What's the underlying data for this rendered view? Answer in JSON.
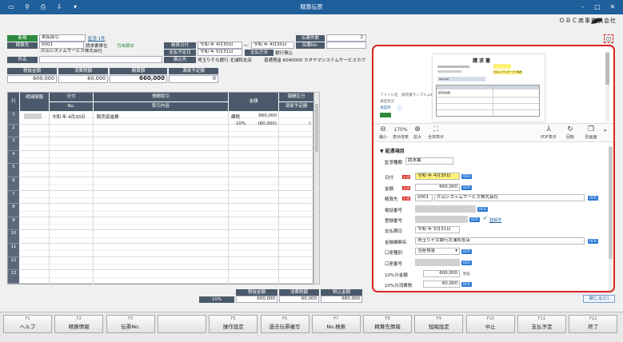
{
  "window": {
    "title": "精算伝票",
    "company": "ＯＢＣ商事株式会社"
  },
  "header": {
    "new_label": "新規",
    "doc_type": "未払取引",
    "voucher_link": "証憑 1件",
    "settlement_date_label": "精算日付",
    "era": "令和",
    "year_unit": "年",
    "settle_from": "4月30日",
    "tilde": "～",
    "settle_to": "4月30日",
    "doc_count_label": "伝票件数",
    "doc_count": "2",
    "payee_label": "精算先",
    "payee_code": "0001",
    "request_unit": "請求書単位",
    "month_end": "月末締め",
    "payment_date_label": "支払予定日",
    "payment_date": "5月31日",
    "payment_method_label": "支払方法",
    "payment_method": "銀行振込",
    "doc_no_label": "伝票No.",
    "payee_name": "片山システムサービス株式会社",
    "subject_label": "件名",
    "transfer_label": "振込先",
    "bank": "埼玉りそな銀行 北浦和支店",
    "account": "普通預金 6040000 カタヤマシステムサービスカブシ"
  },
  "amounts": {
    "tax_excl_label": "税抜金額",
    "tax_label": "消費税額",
    "settle_label": "精算額",
    "adjust_label": "源泉予定額",
    "tax_excl": "600,000",
    "tax": "60,000",
    "settle": "660,000",
    "adjust": "0"
  },
  "grid": {
    "col_row": "行",
    "col_detail": "明細情報",
    "col_date": "日付",
    "col_no": "No.",
    "col_deal": "債務取引",
    "col_content": "取引内容",
    "col_amount": "金額",
    "col_cls": "報酬区分",
    "col_wh": "源泉予定額",
    "row1": {
      "era": "令和",
      "year_unit": "年",
      "date": "4月30日",
      "content": "販売促進費",
      "tax_type": "課税",
      "amount": "660,000",
      "rate": "10%",
      "tax": "(60,000)",
      "withholding": "0"
    },
    "row_numbers": [
      "1",
      "2",
      "3",
      "4",
      "5",
      "6",
      "7",
      "8",
      "9",
      "10",
      "11",
      "12",
      "13"
    ]
  },
  "totals": {
    "tax_excl_label": "税抜金額",
    "tax_label": "消費税額",
    "incl_label": "税込金額",
    "rate": "10%",
    "tax_excl": "600,000",
    "tax": "60,000",
    "incl": "660,000"
  },
  "preview": {
    "zoom": "170%",
    "shrink": "縮小",
    "fit": "表示倍率",
    "enlarge": "拡大",
    "full": "全体表示",
    "pdf": "PDF表示",
    "rotate": "回転",
    "close_view": "別画面",
    "file_name_label": "ファイル名",
    "file_name": "請求書サンプル.pdf",
    "edit_label": "承認状況",
    "status": "承認済",
    "doc_heading": "請求書",
    "doc_company": "片山システムサービス株式会社",
    "doc_item": "販売促進費",
    "doc_total": "660,000"
  },
  "form": {
    "section": "証憑項目",
    "voucher_type_label": "証憑種類",
    "voucher_type": "請求書",
    "date_label": "日付",
    "date_era": "令和",
    "date_year_unit": "年",
    "date_value": "4月30日",
    "amount_label": "金額",
    "amount": "660,000",
    "payee_label": "精算先",
    "payee_code": "0001",
    "payee_name": "片山システムサービス株式会社",
    "phone_label": "電話番号",
    "reg_label": "登録番号",
    "registered": "登録済",
    "due_label": "支払期日",
    "due_era": "令和",
    "due_year_unit": "年",
    "due_date": "5月31日",
    "bank_label": "金融機関名",
    "bank_name": "埼玉りそな銀行北浦和支店",
    "acct_type_label": "口座種別",
    "acct_type": "当座預金",
    "acct_no_label": "口座番号",
    "amount10_label": "10%分金額",
    "amount10": "600,000",
    "tax_excl_tag": "税抜",
    "tax10_label": "10%分消費税",
    "tax10": "60,000",
    "ocr": "OCR",
    "required": "必須"
  },
  "close_button": "閉じる(C)",
  "fkeys": [
    {
      "key": "F1",
      "label": "ヘルプ"
    },
    {
      "key": "F2",
      "label": "精算情報"
    },
    {
      "key": "F3",
      "label": "伝票No."
    },
    {
      "key": "",
      "label": ""
    },
    {
      "key": "F5",
      "label": "操作設定"
    },
    {
      "key": "F6",
      "label": "過去伝票複写"
    },
    {
      "key": "F7",
      "label": "No.検索"
    },
    {
      "key": "F8",
      "label": "精算先情報"
    },
    {
      "key": "F9",
      "label": "短縮設定"
    },
    {
      "key": "F10",
      "label": "中止"
    },
    {
      "key": "F11",
      "label": "支払予定"
    },
    {
      "key": "F12",
      "label": "終了"
    }
  ],
  "colors": {
    "title_bar": "#1f5f9c",
    "header_label": "#4b5a6b",
    "highlight": "#d9251d",
    "ocr_badge": "#2d7bd6",
    "date_highlight": "#fff27a"
  }
}
